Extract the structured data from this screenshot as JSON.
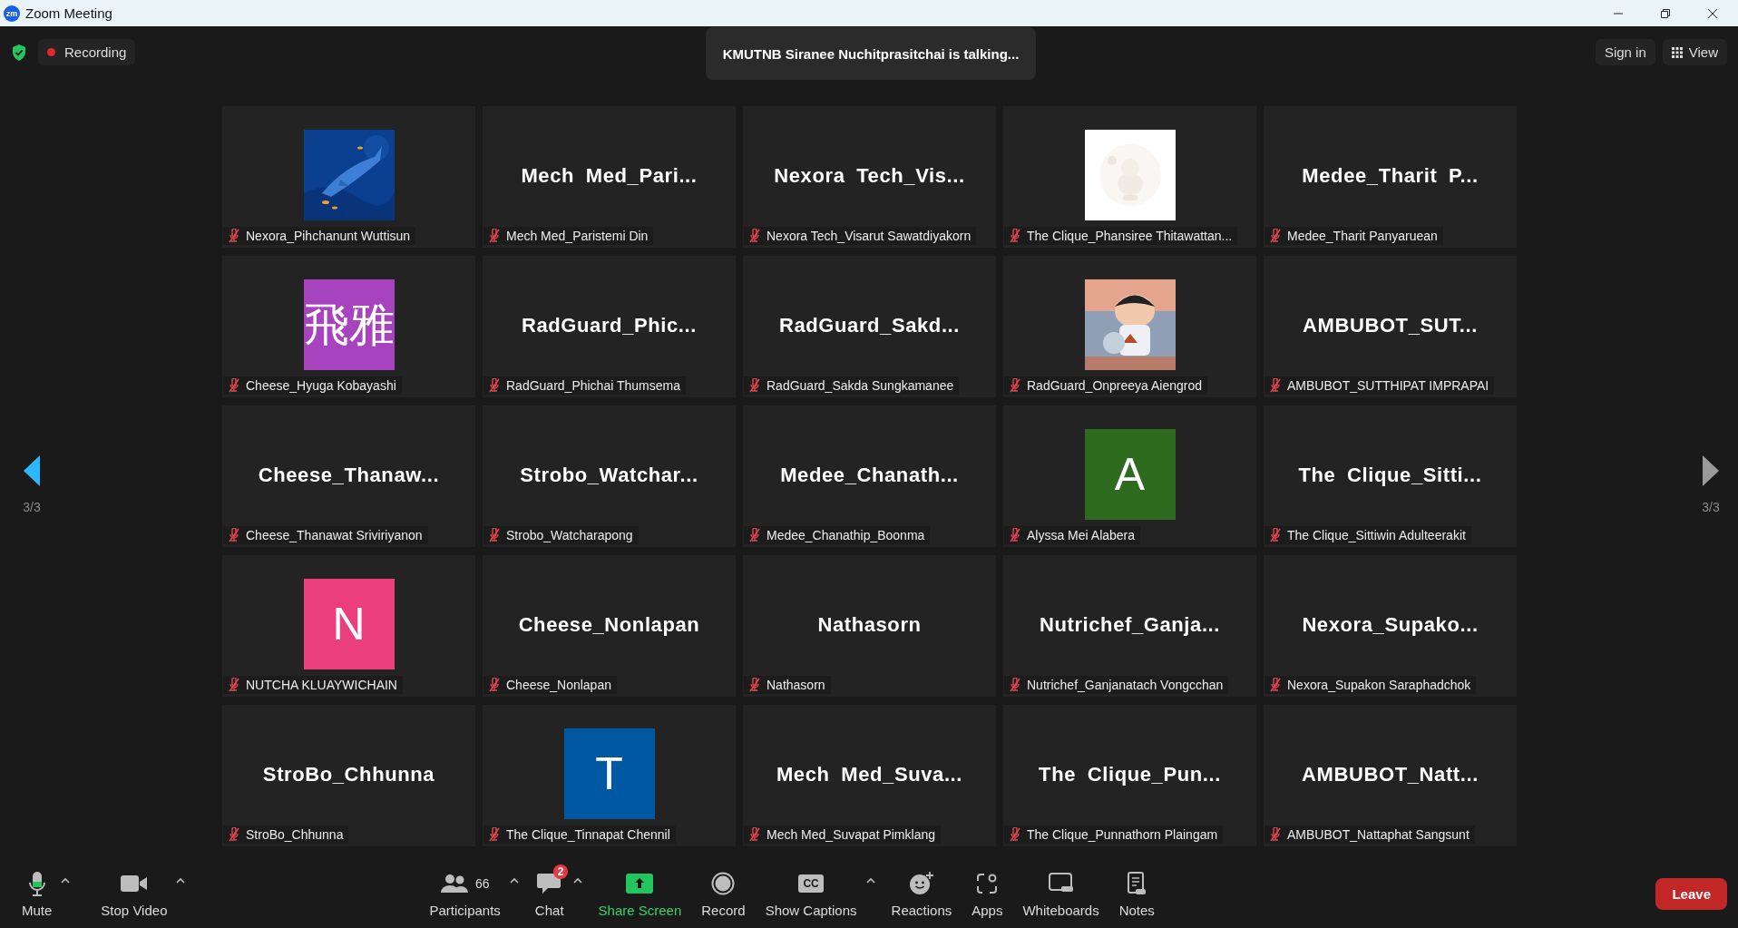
{
  "window": {
    "title": "Zoom Meeting",
    "logo_text": "zm"
  },
  "top_bar": {
    "recording": "Recording",
    "talking_banner": "KMUTNB Siranee Nuchitprasitchai is talking...",
    "sign_in": "Sign in",
    "view": "View"
  },
  "pager": [
    {
      "kind": "left",
      "label": "3/3",
      "highlighted": true
    },
    {
      "kind": "right",
      "label": "3/3",
      "highlighted": false
    }
  ],
  "tiles": [
    {
      "kind": "picture",
      "name": "Nexora_Pihchanunt Wuttisun",
      "muted": true
    },
    {
      "kind": "name",
      "display": "Mech Med_Pari...",
      "name": "Mech Med_Paristemi Din",
      "muted": true
    },
    {
      "kind": "name",
      "display": "Nexora Tech_Vis...",
      "name": "Nexora Tech_Visarut Sawatdiyakorn",
      "muted": true
    },
    {
      "kind": "picture",
      "name": "The Clique_Phansiree Thitawattan...",
      "muted": true
    },
    {
      "kind": "name",
      "display": "Medee_Tharit P...",
      "name": "Medee_Tharit Panyaruean",
      "muted": true
    },
    {
      "kind": "initial",
      "initial": "飛雅",
      "color": "#a843bf",
      "name": "Cheese_Hyuga Kobayashi",
      "muted": true
    },
    {
      "kind": "name",
      "display": "RadGuard_Phic...",
      "name": "RadGuard_Phichai Thumsema",
      "muted": true
    },
    {
      "kind": "name",
      "display": "RadGuard_Sakd...",
      "name": "RadGuard_Sakda Sungkamanee",
      "muted": true
    },
    {
      "kind": "picture",
      "name": "RadGuard_Onpreeya Aiengrod",
      "muted": true
    },
    {
      "kind": "name",
      "display": "AMBUBOT_SUT...",
      "name": "AMBUBOT_SUTTHIPAT IMPRAPAI",
      "muted": true
    },
    {
      "kind": "name",
      "display": "Cheese_Thanaw...",
      "name": "Cheese_Thanawat Sriviriyanon",
      "muted": true
    },
    {
      "kind": "name",
      "display": "Strobo_Watchar...",
      "name": "Strobo_Watcharapong",
      "muted": true
    },
    {
      "kind": "name",
      "display": "Medee_Chanath...",
      "name": "Medee_Chanathip_Boonma",
      "muted": true
    },
    {
      "kind": "initial",
      "initial": "A",
      "color": "#2e6b1e",
      "name": "Alyssa Mei Alabera",
      "muted": true
    },
    {
      "kind": "name",
      "display": "The Clique_Sitti...",
      "name": "The Clique_Sittiwin Adulteerakit",
      "muted": true
    },
    {
      "kind": "initial",
      "initial": "N",
      "color": "#eb3f7b",
      "name": "NUTCHA KLUAYWICHAIN",
      "muted": true
    },
    {
      "kind": "name",
      "display": "Cheese_Nonlapan",
      "name": "Cheese_Nonlapan",
      "muted": true
    },
    {
      "kind": "name",
      "display": "Nathasorn",
      "name": "Nathasorn",
      "muted": true
    },
    {
      "kind": "name",
      "display": "Nutrichef_Ganja...",
      "name": "Nutrichef_Ganjanatach Vongcchan",
      "muted": true
    },
    {
      "kind": "name",
      "display": "Nexora_Supako...",
      "name": "Nexora_Supakon Saraphadchok",
      "muted": true
    },
    {
      "kind": "name",
      "display": "StroBo_Chhunna",
      "name": "StroBo_Chhunna",
      "muted": true
    },
    {
      "kind": "initial",
      "initial": "T",
      "color": "#0058a3",
      "name": "The Clique_Tinnapat Chennil",
      "muted": true
    },
    {
      "kind": "name",
      "display": "Mech Med_Suva...",
      "name": "Mech Med_Suvapat Pimklang",
      "muted": true
    },
    {
      "kind": "name",
      "display": "The Clique_Pun...",
      "name": "The Clique_Punnathorn Plaingam",
      "muted": true
    },
    {
      "kind": "name",
      "display": "AMBUBOT_Natt...",
      "name": "AMBUBOT_Nattaphat Sangsunt",
      "muted": true
    }
  ],
  "toolbar": {
    "left": [
      {
        "kind": "mic",
        "label": "Mute",
        "level": 0.35,
        "caret": true
      },
      {
        "kind": "video",
        "label": "Stop Video",
        "caret": true
      }
    ],
    "center": [
      {
        "kind": "participants",
        "label": "Participants",
        "count": "66",
        "caret": true
      },
      {
        "kind": "chat",
        "label": "Chat",
        "badge": "2",
        "caret": true
      },
      {
        "kind": "share",
        "label": "Share Screen",
        "caret": false
      },
      {
        "kind": "record",
        "label": "Record",
        "caret": false
      },
      {
        "kind": "captions",
        "label": "Show Captions",
        "icon_text": "CC",
        "caret": true
      },
      {
        "kind": "reactions",
        "label": "Reactions",
        "caret": false
      },
      {
        "kind": "apps",
        "label": "Apps",
        "caret": false
      },
      {
        "kind": "whiteboards",
        "label": "Whiteboards",
        "caret": false
      },
      {
        "kind": "notes",
        "label": "Notes",
        "caret": false
      }
    ],
    "leave": "Leave"
  }
}
